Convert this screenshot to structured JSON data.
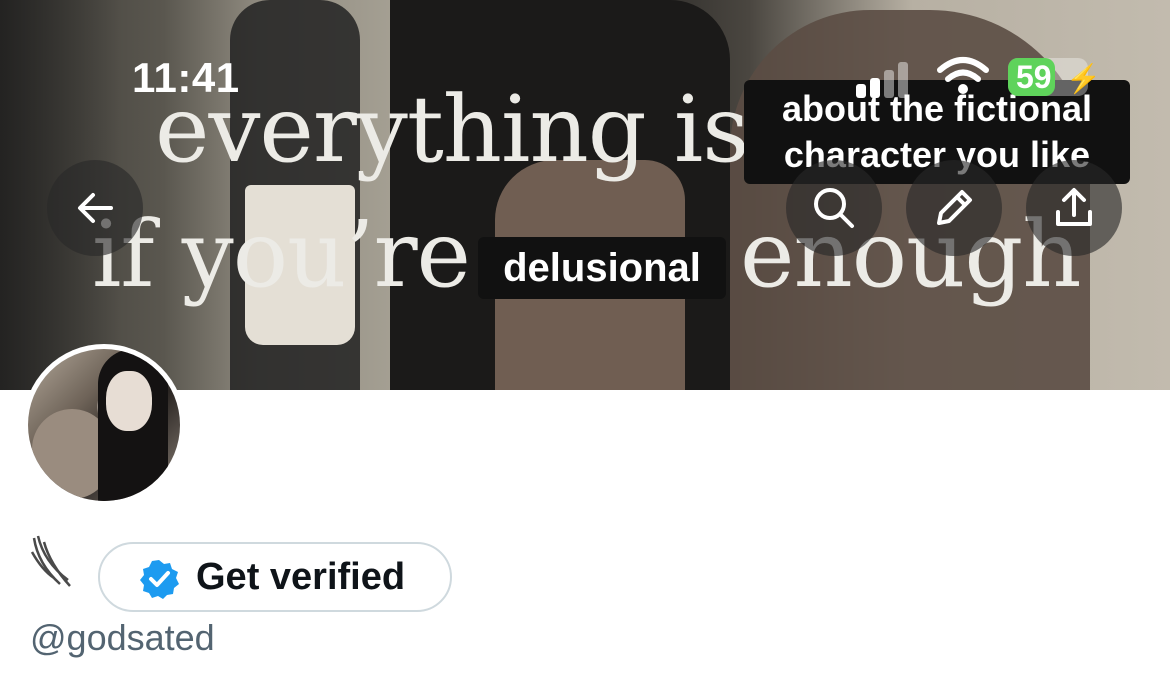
{
  "status_bar": {
    "time": "11:41",
    "battery_level": "59",
    "battery_fraction": 0.59,
    "battery_color": "#5fd35b"
  },
  "banner": {
    "overlay_line_1": "everything is",
    "overlay_line_2a": "if you’re",
    "overlay_line_2b": "enough",
    "caption_fictional": "about the fictional\ncharacter you like",
    "caption_delusional": "delusional"
  },
  "actions": {
    "back_icon": "arrow-left-icon",
    "search_icon": "search-icon",
    "edit_icon": "pencil-icon",
    "share_icon": "share-icon"
  },
  "profile": {
    "verify_button_label": "Get verified",
    "verify_badge_color": "#1d9bf0",
    "handle": "@godsated"
  }
}
